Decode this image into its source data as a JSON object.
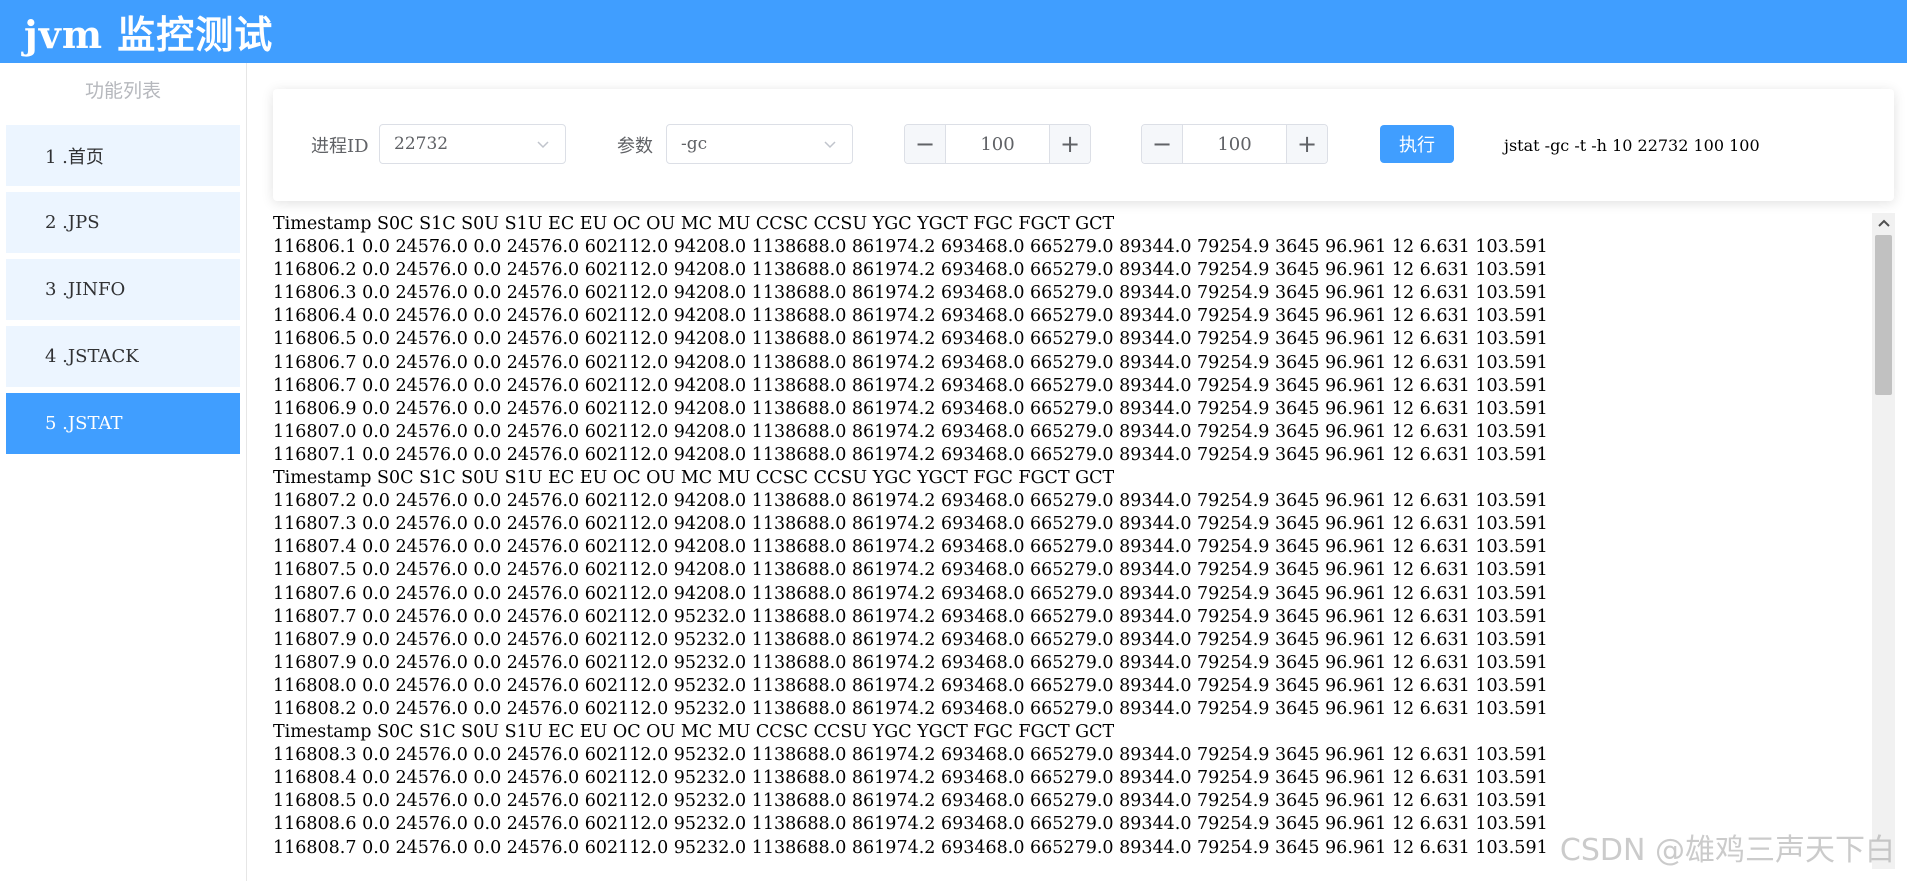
{
  "header": {
    "title": "jvm 监控测试"
  },
  "sidebar": {
    "title": "功能列表",
    "items": [
      {
        "label": "1 .首页"
      },
      {
        "label": "2 .JPS"
      },
      {
        "label": "3 .JINFO"
      },
      {
        "label": "4 .JSTACK"
      },
      {
        "label": "5 .JSTAT"
      }
    ],
    "active_index": 4
  },
  "toolbar": {
    "pid_label": "进程ID",
    "pid_value": "22732",
    "param_label": "参数",
    "param_value": "-gc",
    "interval_minus": "−",
    "interval_value": "100",
    "interval_plus": "+",
    "count_minus": "−",
    "count_value": "100",
    "count_plus": "+",
    "run_label": "执行",
    "command_text": "jstat -gc -t -h 10 22732 100 100"
  },
  "output": {
    "lines": [
      "Timestamp S0C S1C S0U S1U EC EU OC OU MC MU CCSC CCSU YGC YGCT FGC FGCT GCT",
      "116806.1 0.0 24576.0 0.0 24576.0 602112.0 94208.0 1138688.0 861974.2 693468.0 665279.0 89344.0 79254.9 3645 96.961 12 6.631 103.591",
      "116806.2 0.0 24576.0 0.0 24576.0 602112.0 94208.0 1138688.0 861974.2 693468.0 665279.0 89344.0 79254.9 3645 96.961 12 6.631 103.591",
      "116806.3 0.0 24576.0 0.0 24576.0 602112.0 94208.0 1138688.0 861974.2 693468.0 665279.0 89344.0 79254.9 3645 96.961 12 6.631 103.591",
      "116806.4 0.0 24576.0 0.0 24576.0 602112.0 94208.0 1138688.0 861974.2 693468.0 665279.0 89344.0 79254.9 3645 96.961 12 6.631 103.591",
      "116806.5 0.0 24576.0 0.0 24576.0 602112.0 94208.0 1138688.0 861974.2 693468.0 665279.0 89344.0 79254.9 3645 96.961 12 6.631 103.591",
      "116806.7 0.0 24576.0 0.0 24576.0 602112.0 94208.0 1138688.0 861974.2 693468.0 665279.0 89344.0 79254.9 3645 96.961 12 6.631 103.591",
      "116806.7 0.0 24576.0 0.0 24576.0 602112.0 94208.0 1138688.0 861974.2 693468.0 665279.0 89344.0 79254.9 3645 96.961 12 6.631 103.591",
      "116806.9 0.0 24576.0 0.0 24576.0 602112.0 94208.0 1138688.0 861974.2 693468.0 665279.0 89344.0 79254.9 3645 96.961 12 6.631 103.591",
      "116807.0 0.0 24576.0 0.0 24576.0 602112.0 94208.0 1138688.0 861974.2 693468.0 665279.0 89344.0 79254.9 3645 96.961 12 6.631 103.591",
      "116807.1 0.0 24576.0 0.0 24576.0 602112.0 94208.0 1138688.0 861974.2 693468.0 665279.0 89344.0 79254.9 3645 96.961 12 6.631 103.591",
      "Timestamp S0C S1C S0U S1U EC EU OC OU MC MU CCSC CCSU YGC YGCT FGC FGCT GCT",
      "116807.2 0.0 24576.0 0.0 24576.0 602112.0 94208.0 1138688.0 861974.2 693468.0 665279.0 89344.0 79254.9 3645 96.961 12 6.631 103.591",
      "116807.3 0.0 24576.0 0.0 24576.0 602112.0 94208.0 1138688.0 861974.2 693468.0 665279.0 89344.0 79254.9 3645 96.961 12 6.631 103.591",
      "116807.4 0.0 24576.0 0.0 24576.0 602112.0 94208.0 1138688.0 861974.2 693468.0 665279.0 89344.0 79254.9 3645 96.961 12 6.631 103.591",
      "116807.5 0.0 24576.0 0.0 24576.0 602112.0 94208.0 1138688.0 861974.2 693468.0 665279.0 89344.0 79254.9 3645 96.961 12 6.631 103.591",
      "116807.6 0.0 24576.0 0.0 24576.0 602112.0 94208.0 1138688.0 861974.2 693468.0 665279.0 89344.0 79254.9 3645 96.961 12 6.631 103.591",
      "116807.7 0.0 24576.0 0.0 24576.0 602112.0 95232.0 1138688.0 861974.2 693468.0 665279.0 89344.0 79254.9 3645 96.961 12 6.631 103.591",
      "116807.9 0.0 24576.0 0.0 24576.0 602112.0 95232.0 1138688.0 861974.2 693468.0 665279.0 89344.0 79254.9 3645 96.961 12 6.631 103.591",
      "116807.9 0.0 24576.0 0.0 24576.0 602112.0 95232.0 1138688.0 861974.2 693468.0 665279.0 89344.0 79254.9 3645 96.961 12 6.631 103.591",
      "116808.0 0.0 24576.0 0.0 24576.0 602112.0 95232.0 1138688.0 861974.2 693468.0 665279.0 89344.0 79254.9 3645 96.961 12 6.631 103.591",
      "116808.2 0.0 24576.0 0.0 24576.0 602112.0 95232.0 1138688.0 861974.2 693468.0 665279.0 89344.0 79254.9 3645 96.961 12 6.631 103.591",
      "Timestamp S0C S1C S0U S1U EC EU OC OU MC MU CCSC CCSU YGC YGCT FGC FGCT GCT",
      "116808.3 0.0 24576.0 0.0 24576.0 602112.0 95232.0 1138688.0 861974.2 693468.0 665279.0 89344.0 79254.9 3645 96.961 12 6.631 103.591",
      "116808.4 0.0 24576.0 0.0 24576.0 602112.0 95232.0 1138688.0 861974.2 693468.0 665279.0 89344.0 79254.9 3645 96.961 12 6.631 103.591",
      "116808.5 0.0 24576.0 0.0 24576.0 602112.0 95232.0 1138688.0 861974.2 693468.0 665279.0 89344.0 79254.9 3645 96.961 12 6.631 103.591",
      "116808.6 0.0 24576.0 0.0 24576.0 602112.0 95232.0 1138688.0 861974.2 693468.0 665279.0 89344.0 79254.9 3645 96.961 12 6.631 103.591",
      "116808.7 0.0 24576.0 0.0 24576.0 602112.0 95232.0 1138688.0 861974.2 693468.0 665279.0 89344.0 79254.9 3645 96.961 12 6.631 103.591"
    ]
  },
  "icons": {
    "select_arrow": "chevron-down-icon",
    "scroll_up": "arrow-up-icon"
  },
  "colors": {
    "primary": "#409eff",
    "menu_bg": "#ecf5ff"
  },
  "watermark": "CSDN @雄鸡三声天下白"
}
